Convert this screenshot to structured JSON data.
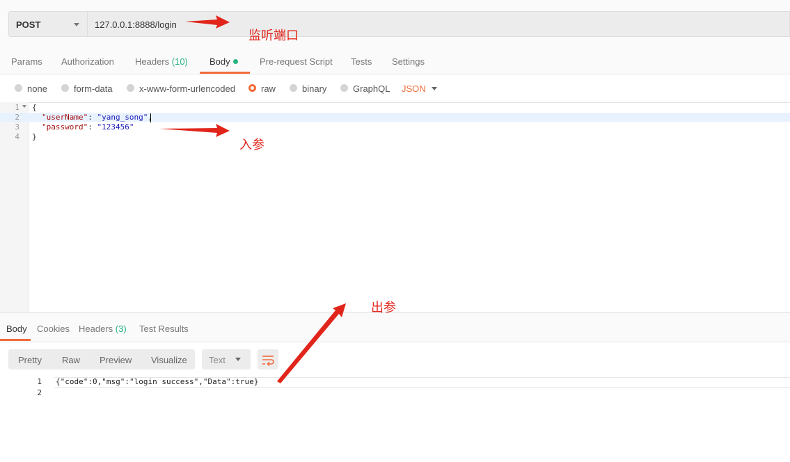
{
  "request": {
    "method": "POST",
    "url": "127.0.0.1:8888/login"
  },
  "request_tabs": {
    "params": "Params",
    "authorization": "Authorization",
    "headers": "Headers",
    "headers_count": "(10)",
    "body": "Body",
    "pre_request": "Pre-request Script",
    "tests": "Tests",
    "settings": "Settings"
  },
  "body_type": {
    "none": "none",
    "form_data": "form-data",
    "urlencoded": "x-www-form-urlencoded",
    "raw": "raw",
    "binary": "binary",
    "graphql": "GraphQL",
    "format": "JSON",
    "selected": "raw"
  },
  "editor": {
    "line_numbers": [
      "1",
      "2",
      "3",
      "4"
    ],
    "open_brace": "{",
    "close_brace": "}",
    "key1": "\"userName\"",
    "val1": "\"yang_song\"",
    "key2": "\"password\"",
    "val2": "\"123456\""
  },
  "response_tabs": {
    "body": "Body",
    "cookies": "Cookies",
    "headers": "Headers",
    "headers_count": "(3)",
    "test_results": "Test Results"
  },
  "response_view": {
    "pretty": "Pretty",
    "raw": "Raw",
    "preview": "Preview",
    "visualize": "Visualize",
    "format": "Text"
  },
  "response_body": {
    "line_numbers": [
      "1",
      "2"
    ],
    "line1": "{\"code\":0,\"msg\":\"login success\",\"Data\":true}"
  },
  "annotations": {
    "port": "监听端口",
    "input": "入参",
    "output": "出参"
  },
  "colors": {
    "accent": "#f26b3a",
    "green": "#26b47f",
    "annotation_red": "#e1251b"
  }
}
